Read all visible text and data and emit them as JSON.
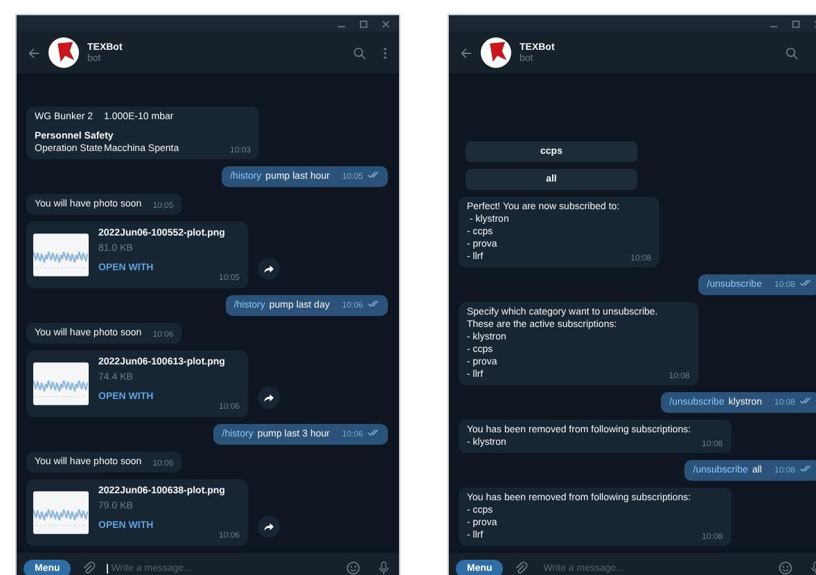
{
  "windows": [
    {
      "header": {
        "name": "TEXBot",
        "status": "bot"
      },
      "messages": [
        {
          "kind": "status",
          "lines": [
            {
              "kind": "row",
              "cells": [
                "WG Bunker 2",
                "1.000E-10 mbar"
              ]
            },
            {
              "kind": "gap"
            },
            {
              "kind": "heading",
              "text": "Personnel Safety"
            },
            {
              "kind": "row",
              "cells": [
                "Operation State",
                "Macchina Spenta"
              ]
            }
          ],
          "time": "10:03"
        },
        {
          "kind": "out",
          "command": "/history",
          "text": "pump last hour",
          "time": "10:05",
          "read": true
        },
        {
          "kind": "in",
          "text": "You will have photo soon",
          "time": "10:05"
        },
        {
          "kind": "file",
          "name": "2022Jun06-100552-plot.png",
          "size": "81.0 KB",
          "action": "OPEN WITH",
          "time": "10:05"
        },
        {
          "kind": "out",
          "command": "/history",
          "text": "pump last day",
          "time": "10:06",
          "read": true
        },
        {
          "kind": "in",
          "text": "You will have photo soon",
          "time": "10:06"
        },
        {
          "kind": "file",
          "name": "2022Jun06-100613-plot.png",
          "size": "74.4 KB",
          "action": "OPEN WITH",
          "time": "10:06"
        },
        {
          "kind": "out",
          "command": "/history",
          "text": "pump last 3 hour",
          "time": "10:06",
          "read": true
        },
        {
          "kind": "in",
          "text": "You will have photo soon",
          "time": "10:06"
        },
        {
          "kind": "file",
          "name": "2022Jun06-100638-plot.png",
          "size": "79.0 KB",
          "action": "OPEN WITH",
          "time": "10:06"
        }
      ],
      "composer": {
        "menu": "Menu",
        "placeholder": "Write a message...",
        "focused": true
      }
    },
    {
      "header": {
        "name": "TEXBot",
        "status": "bot"
      },
      "messages": [
        {
          "kind": "key",
          "label": "ccps"
        },
        {
          "kind": "key",
          "label": "all"
        },
        {
          "kind": "in",
          "text": "Perfect! You are now subscribed to:\n - klystron\n- ccps\n- prova\n- llrf",
          "time": "10:08"
        },
        {
          "kind": "out",
          "command": "/unsubscribe",
          "time": "10:08",
          "read": true
        },
        {
          "kind": "in",
          "text": "Specify which category want to unsubscribe.\nThese are the active subscriptions:\n- klystron\n- ccps\n- prova\n- llrf",
          "time": "10:08"
        },
        {
          "kind": "out",
          "command": "/unsubscribe",
          "text": "klystron",
          "time": "10:08",
          "read": true
        },
        {
          "kind": "in",
          "text": "You has been removed from following subscriptions:\n- klystron",
          "time": "10:08"
        },
        {
          "kind": "out",
          "command": "/unsubscribe",
          "text": "all",
          "time": "10:08",
          "read": true
        },
        {
          "kind": "in",
          "text": "You has been removed from following subscriptions:\n- ccps\n- prova\n- llrf",
          "time": "10:08"
        }
      ],
      "composer": {
        "menu": "Menu",
        "placeholder": "Write a message...",
        "focused": false
      }
    }
  ]
}
